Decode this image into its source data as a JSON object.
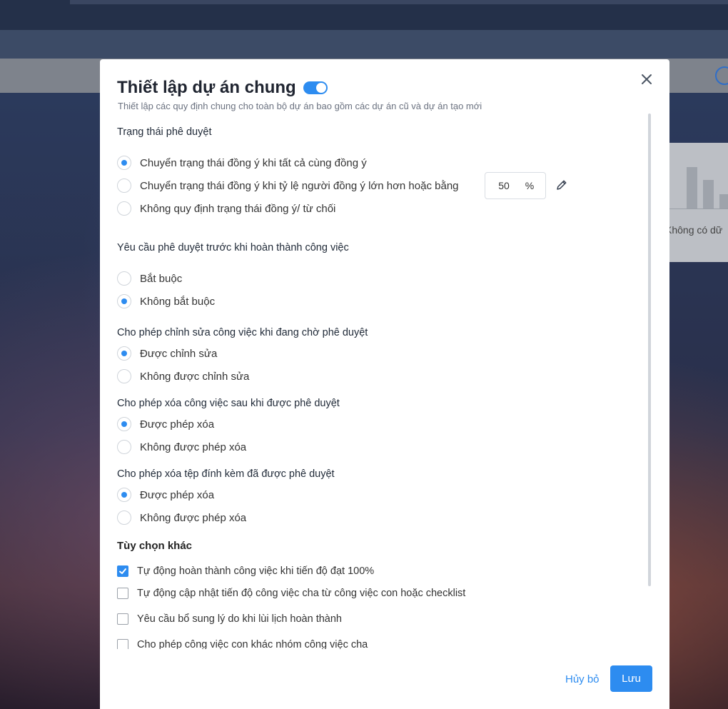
{
  "background": {
    "card_text": "Không có dữ"
  },
  "modal": {
    "title": "Thiết lập dự án chung",
    "toggle_on": true,
    "subtitle": "Thiết lập các quy định chung cho toàn bộ dự án bao gồm các dự án cũ và dự án tạo mới",
    "sections": {
      "approval_status": {
        "title": "Trạng thái phê duyệt",
        "options": [
          {
            "label": "Chuyển trạng thái đồng ý khi tất cả cùng đồng ý",
            "selected": true
          },
          {
            "label": "Chuyển trạng thái đồng ý khi tỷ lệ người đồng ý lớn hơn hoặc bằng",
            "selected": false
          },
          {
            "label": "Không quy định trạng thái đồng ý/ từ chối",
            "selected": false
          }
        ],
        "percent_value": "50",
        "percent_unit": "%"
      },
      "require_approval": {
        "title": "Yêu cầu phê duyệt trước khi hoàn thành công việc",
        "options": [
          {
            "label": "Bắt buộc",
            "selected": false
          },
          {
            "label": "Không bắt buộc",
            "selected": true
          }
        ]
      },
      "edit_pending": {
        "title": "Cho phép chỉnh sửa công việc khi đang chờ phê duyệt",
        "options": [
          {
            "label": "Được chỉnh sửa",
            "selected": true
          },
          {
            "label": "Không được chỉnh sửa",
            "selected": false
          }
        ]
      },
      "delete_task": {
        "title": "Cho phép xóa công việc sau khi được phê duyệt",
        "options": [
          {
            "label": "Được phép xóa",
            "selected": true
          },
          {
            "label": "Không được phép xóa",
            "selected": false
          }
        ]
      },
      "delete_attachment": {
        "title": "Cho phép xóa tệp đính kèm đã được phê duyệt",
        "options": [
          {
            "label": "Được phép xóa",
            "selected": true
          },
          {
            "label": "Không được phép xóa",
            "selected": false
          }
        ]
      },
      "other": {
        "title": "Tùy chọn khác",
        "options": [
          {
            "label": "Tự động hoàn thành công việc khi tiến độ đạt 100%",
            "checked": true
          },
          {
            "label": "Tự động cập nhật tiến độ công việc cha từ công việc con hoặc checklist",
            "checked": false
          },
          {
            "label": "Yêu cầu bổ sung lý do khi lùi lịch hoàn thành",
            "checked": false
          },
          {
            "label": "Cho phép công việc con khác nhóm công việc cha",
            "checked": false
          }
        ]
      }
    },
    "footer": {
      "cancel_label": "Hủy bỏ",
      "save_label": "Lưu"
    }
  },
  "colors": {
    "accent": "#2d8cf0"
  }
}
